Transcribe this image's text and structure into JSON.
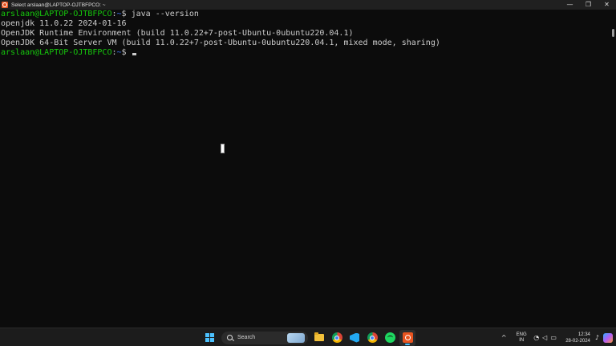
{
  "window": {
    "title": "Select arslaan@LAPTOP-OJTBFPCO: ~",
    "controls": {
      "minimize": "—",
      "maximize": "❐",
      "close": "✕"
    }
  },
  "terminal": {
    "lines": [
      {
        "type": "prompt",
        "user": "arslaan@LAPTOP-OJTBFPCO",
        "sep": ":",
        "path": "~",
        "symbol": "$ ",
        "command": "java --version"
      },
      {
        "type": "output",
        "text": "openjdk 11.0.22 2024-01-16"
      },
      {
        "type": "output",
        "text": "OpenJDK Runtime Environment (build 11.0.22+7-post-Ubuntu-0ubuntu220.04.1)"
      },
      {
        "type": "output",
        "text": "OpenJDK 64-Bit Server VM (build 11.0.22+7-post-Ubuntu-0ubuntu220.04.1, mixed mode, sharing)"
      },
      {
        "type": "prompt",
        "user": "arslaan@LAPTOP-OJTBFPCO",
        "sep": ":",
        "path": "~",
        "symbol": "$ ",
        "command": ""
      }
    ],
    "colors": {
      "background": "#0c0c0c",
      "text": "#cccccc",
      "user": "#16c60c",
      "path": "#3b78ff"
    }
  },
  "taskbar": {
    "search_placeholder": "Search",
    "apps": [
      "windows-start-icon",
      "search",
      "file-explorer-icon",
      "chrome-icon",
      "vscode-icon",
      "chrome-profile-icon",
      "spotify-icon",
      "ubuntu-terminal-icon"
    ],
    "tray": {
      "chevron": "^",
      "lang_line1": "ENG",
      "lang_line2": "IN",
      "time": "12:34",
      "date": "28-02-2024"
    }
  }
}
